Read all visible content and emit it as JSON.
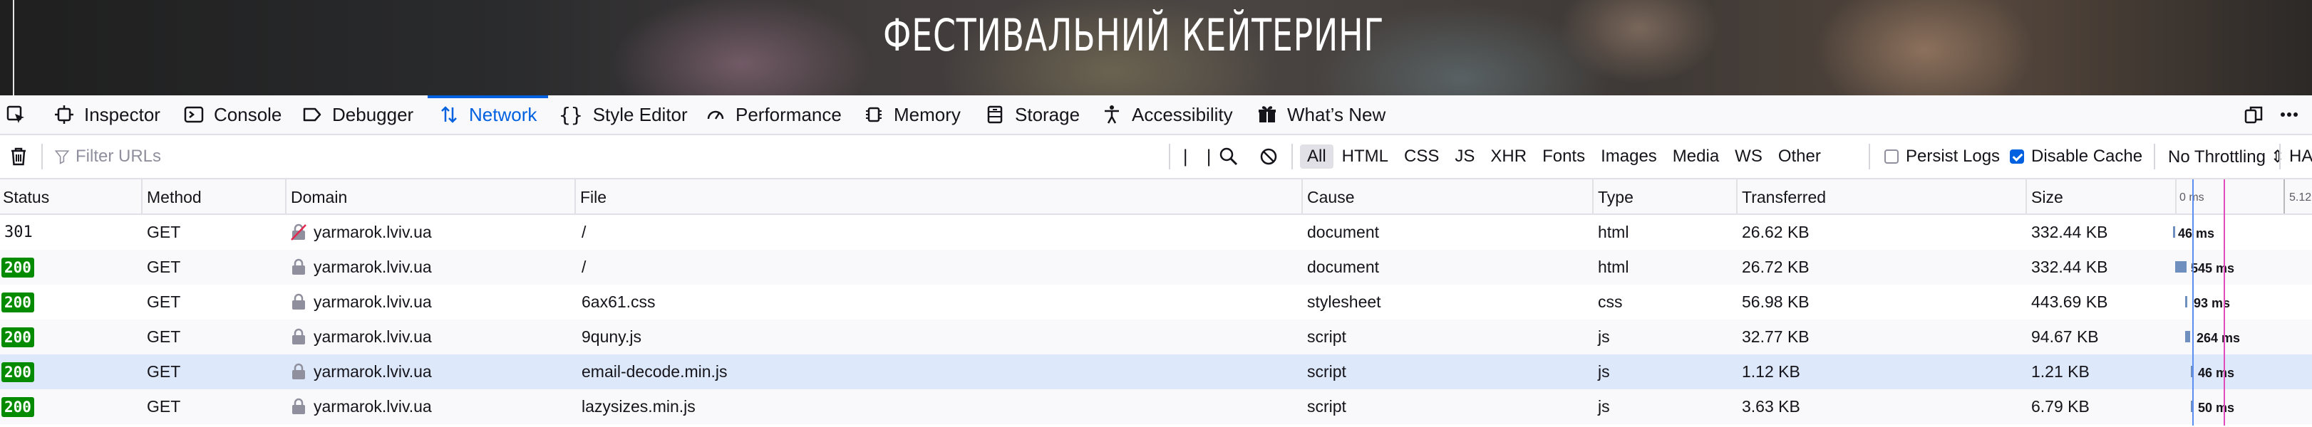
{
  "page": {
    "heading": "ФЕСТИВАЛЬНИЙ КЕЙТЕРИНГ"
  },
  "toolbar": {
    "tools": [
      {
        "label": "Inspector"
      },
      {
        "label": "Console"
      },
      {
        "label": "Debugger"
      },
      {
        "label": "Network",
        "active": true
      },
      {
        "label": "Style Editor"
      },
      {
        "label": "Performance"
      },
      {
        "label": "Memory"
      },
      {
        "label": "Storage"
      },
      {
        "label": "Accessibility"
      },
      {
        "label": "What’s New"
      }
    ]
  },
  "filterbar": {
    "filter_placeholder": "Filter URLs",
    "pause_label": "| |",
    "types": [
      "All",
      "HTML",
      "CSS",
      "JS",
      "XHR",
      "Fonts",
      "Images",
      "Media",
      "WS",
      "Other"
    ],
    "selected_type": "All",
    "persist_logs_label": "Persist Logs",
    "persist_logs_checked": false,
    "disable_cache_label": "Disable Cache",
    "disable_cache_checked": true,
    "throttling_value": "No Throttling ⇕",
    "har_label": "HAR"
  },
  "table": {
    "columns": [
      "Status",
      "Method",
      "Domain",
      "File",
      "Cause",
      "Type",
      "Transferred",
      "Size"
    ],
    "waterfall_ticks": [
      "0 ms",
      "5.12"
    ],
    "rows": [
      {
        "status": "301",
        "method": "GET",
        "domain": "yarmarok.lviv.ua",
        "file": "/",
        "cause": "document",
        "type": "html",
        "transferred": "26.62 KB",
        "size": "332.44 KB",
        "time": "46 ms",
        "insecure": true
      },
      {
        "status": "200",
        "method": "GET",
        "domain": "yarmarok.lviv.ua",
        "file": "/",
        "cause": "document",
        "type": "html",
        "transferred": "26.72 KB",
        "size": "332.44 KB",
        "time": "545 ms"
      },
      {
        "status": "200",
        "method": "GET",
        "domain": "yarmarok.lviv.ua",
        "file": "6ax61.css",
        "cause": "stylesheet",
        "type": "css",
        "transferred": "56.98 KB",
        "size": "443.69 KB",
        "time": "93 ms"
      },
      {
        "status": "200",
        "method": "GET",
        "domain": "yarmarok.lviv.ua",
        "file": "9quny.js",
        "cause": "script",
        "type": "js",
        "transferred": "32.77 KB",
        "size": "94.67 KB",
        "time": "264 ms"
      },
      {
        "status": "200",
        "method": "GET",
        "domain": "yarmarok.lviv.ua",
        "file": "email-decode.min.js",
        "cause": "script",
        "type": "js",
        "transferred": "1.12 KB",
        "size": "1.21 KB",
        "time": "46 ms",
        "selected": true
      },
      {
        "status": "200",
        "method": "GET",
        "domain": "yarmarok.lviv.ua",
        "file": "lazysizes.min.js",
        "cause": "script",
        "type": "js",
        "transferred": "3.63 KB",
        "size": "6.79 KB",
        "time": "50 ms"
      }
    ]
  },
  "colors": {
    "accent": "#0061e0",
    "status_ok": "#058b00",
    "selected_row": "#dde9fb",
    "waterfall_bar": "#6f8fbf",
    "dom_loaded_marker": "#5b8ef0",
    "load_marker": "#e14cbc"
  },
  "icons": {
    "toolbar": [
      "element-picker-icon",
      "inspector-icon",
      "console-icon",
      "debugger-icon",
      "network-icon",
      "style-editor-icon",
      "performance-icon",
      "memory-icon",
      "storage-icon",
      "accessibility-icon",
      "whats-new-icon"
    ],
    "right": [
      "dock-icon",
      "more-options-icon"
    ],
    "filterbar": [
      "trash-icon",
      "filter-icon",
      "search-icon",
      "block-icon"
    ]
  }
}
